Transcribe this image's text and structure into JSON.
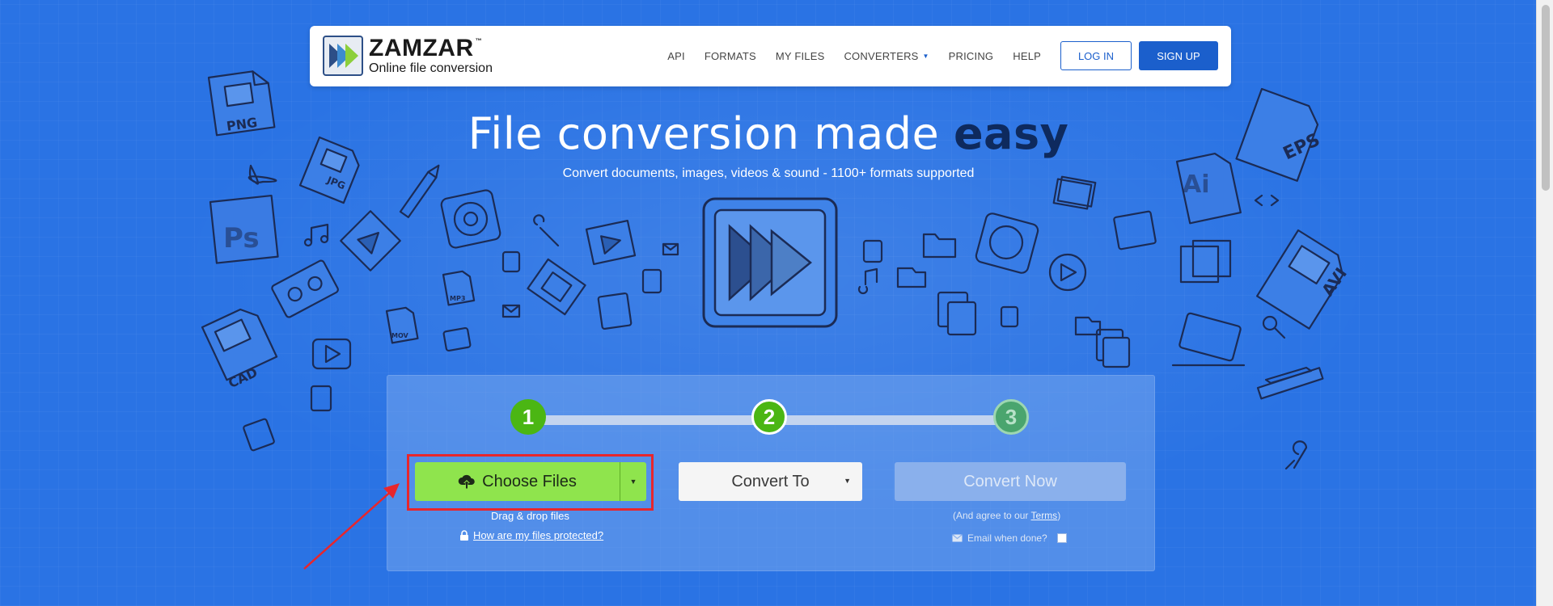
{
  "colors": {
    "background": "#2a73e4",
    "primary": "#1b5fcc",
    "choose_button": "#8fe44d",
    "step_active": "#4bb613",
    "highlight": "#e8262c"
  },
  "logo": {
    "name": "ZAMZAR",
    "trademark": "™",
    "tagline": "Online file conversion"
  },
  "nav": {
    "items": [
      {
        "label": "API"
      },
      {
        "label": "FORMATS"
      },
      {
        "label": "MY FILES"
      },
      {
        "label": "CONVERTERS",
        "dropdown": true
      },
      {
        "label": "PRICING"
      },
      {
        "label": "HELP"
      }
    ],
    "login_label": "LOG IN",
    "signup_label": "SIGN UP"
  },
  "hero": {
    "title_main": "File conversion made ",
    "title_emphasis": "easy",
    "subtitle": "Convert documents, images, videos & sound - 1100+ formats supported"
  },
  "doodles": {
    "labels": [
      "PNG",
      "JPG",
      "Ps",
      "CAD",
      "EPS",
      "Ai",
      "AVI",
      "MP3",
      "MOV"
    ]
  },
  "converter": {
    "steps": [
      {
        "number": "1",
        "state": "active"
      },
      {
        "number": "2",
        "state": "active"
      },
      {
        "number": "3",
        "state": "pending"
      }
    ],
    "choose_files_label": "Choose Files",
    "drag_drop_label": "Drag & drop files",
    "protected_link_label": "How are my files protected?",
    "convert_to_label": "Convert To",
    "convert_now_label": "Convert Now",
    "agree_prefix": "(And agree to our ",
    "agree_link": "Terms",
    "agree_suffix": ")",
    "email_label": "Email when done?",
    "email_checked": false
  }
}
